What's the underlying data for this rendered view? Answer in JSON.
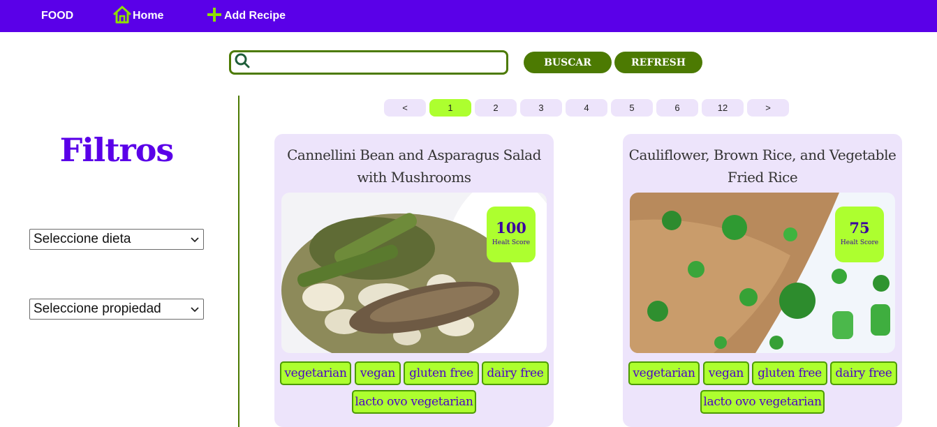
{
  "nav": {
    "brand": "FOOD",
    "home": "Home",
    "add_recipe": "Add Recipe"
  },
  "search": {
    "placeholder": "",
    "value": "",
    "buscar_label": "BUSCAR",
    "refresh_label": "REFRESH"
  },
  "sidebar": {
    "title": "Filtros",
    "diet_select": "Seleccione dieta",
    "property_select": "Seleccione propiedad"
  },
  "pagination": [
    "<",
    "1",
    "2",
    "3",
    "4",
    "5",
    "6",
    "12",
    ">"
  ],
  "pagination_active": "1",
  "recipes": [
    {
      "title": "Cannellini Bean and Asparagus Salad with Mushrooms",
      "health_score": "100",
      "health_label": "Healt Score",
      "diets": [
        "vegetarian",
        "vegan",
        "gluten free",
        "dairy free",
        "lacto ovo vegetarian"
      ]
    },
    {
      "title": "Cauliflower, Brown Rice, and Vegetable Fried Rice",
      "health_score": "75",
      "health_label": "Healt Score",
      "diets": [
        "vegetarian",
        "vegan",
        "gluten free",
        "dairy free",
        "lacto ovo vegetarian"
      ]
    }
  ],
  "colors": {
    "navbar": "#5a00e8",
    "accent_green": "#4c7a02",
    "lime": "#adff2f",
    "card_bg": "#ede4fb",
    "filters_title": "#5a00e8"
  }
}
